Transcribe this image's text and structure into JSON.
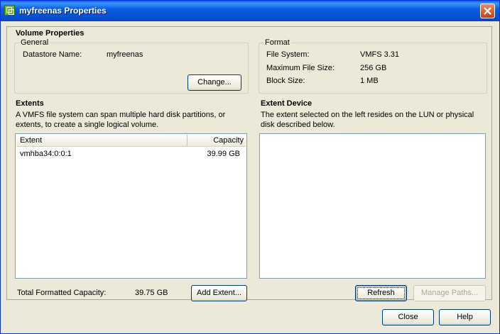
{
  "window": {
    "title": "myfreenas Properties"
  },
  "volume_properties": {
    "heading": "Volume Properties",
    "general": {
      "legend": "General",
      "datastore_name_label": "Datastore Name:",
      "datastore_name_value": "myfreenas",
      "change_button": "Change..."
    },
    "format": {
      "legend": "Format",
      "rows": [
        {
          "label": "File System:",
          "value": "VMFS 3.31"
        },
        {
          "label": "Maximum File Size:",
          "value": "256 GB"
        },
        {
          "label": "Block Size:",
          "value": "1 MB"
        }
      ]
    }
  },
  "extents": {
    "heading": "Extents",
    "description": "A VMFS file system can span multiple hard disk partitions, or extents, to create a single logical volume.",
    "columns": [
      "Extent",
      "Capacity"
    ],
    "rows": [
      {
        "extent": "vmhba34:0:0:1",
        "capacity": "39.99 GB"
      }
    ],
    "total_label": "Total Formatted Capacity:",
    "total_value": "39.75 GB",
    "add_button": "Add Extent..."
  },
  "extent_device": {
    "heading": "Extent Device",
    "description": "The extent selected on the left resides on the LUN or physical disk described below.",
    "refresh_button": "Refresh",
    "manage_paths_button": "Manage Paths..."
  },
  "footer": {
    "close_button": "Close",
    "help_button": "Help"
  }
}
